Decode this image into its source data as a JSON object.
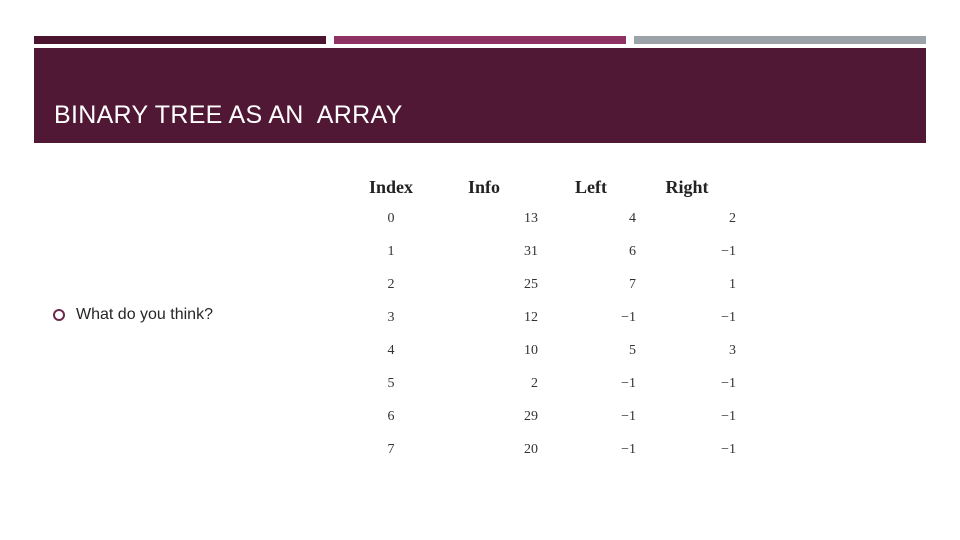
{
  "header": {
    "title": "BINARY TREE AS AN  ARRAY",
    "accent_bars": [
      "#4b1530",
      "#8e3163",
      "#9ba2a8"
    ],
    "band_color": "#501834"
  },
  "body": {
    "bullet_icon": "hollow-circle-icon",
    "bullet_text": "What do you think?"
  },
  "table": {
    "columns": [
      "Index",
      "Info",
      "Left",
      "Right"
    ],
    "rows": [
      [
        "0",
        "13",
        "4",
        "2"
      ],
      [
        "1",
        "31",
        "6",
        "−1"
      ],
      [
        "2",
        "25",
        "7",
        "1"
      ],
      [
        "3",
        "12",
        "−1",
        "−1"
      ],
      [
        "4",
        "10",
        "5",
        "3"
      ],
      [
        "5",
        "2",
        "−1",
        "−1"
      ],
      [
        "6",
        "29",
        "−1",
        "−1"
      ],
      [
        "7",
        "20",
        "−1",
        "−1"
      ]
    ]
  }
}
